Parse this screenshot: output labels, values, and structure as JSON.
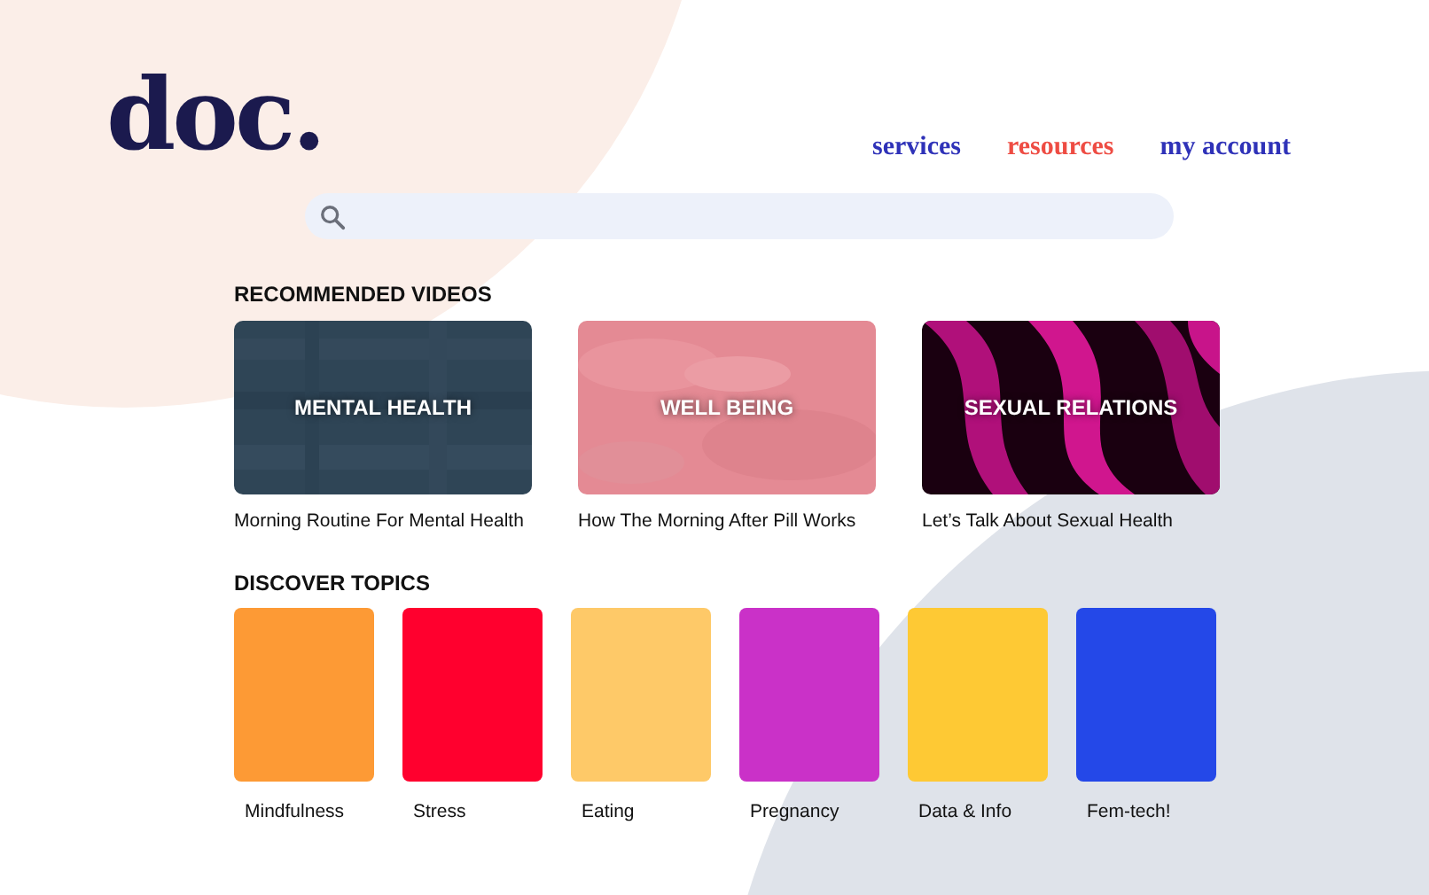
{
  "logo": "doc.",
  "nav": [
    {
      "label": "services",
      "selected": false
    },
    {
      "label": "resources",
      "selected": true
    },
    {
      "label": "my account",
      "selected": false
    }
  ],
  "recommended": {
    "heading": "RECOMMENDED VIDEOS",
    "videos": [
      {
        "label": "MENTAL HEALTH",
        "title": "Morning Routine For Mental Health"
      },
      {
        "label": "WELL BEING",
        "title": "How The Morning After Pill Works"
      },
      {
        "label": "SEXUAL RELATIONS",
        "title": "Let’s Talk About Sexual Health"
      }
    ]
  },
  "topics": {
    "heading": "DISCOVER TOPICS",
    "items": [
      {
        "label": "Mindfulness",
        "color": "#fd9a35"
      },
      {
        "label": "Stress",
        "color": "#ff002e"
      },
      {
        "label": "Eating",
        "color": "#fec968"
      },
      {
        "label": "Pregnancy",
        "color": "#ca31c8"
      },
      {
        "label": "Data & Info",
        "color": "#fec934"
      },
      {
        "label": "Fem-tech!",
        "color": "#2448e8"
      }
    ]
  }
}
